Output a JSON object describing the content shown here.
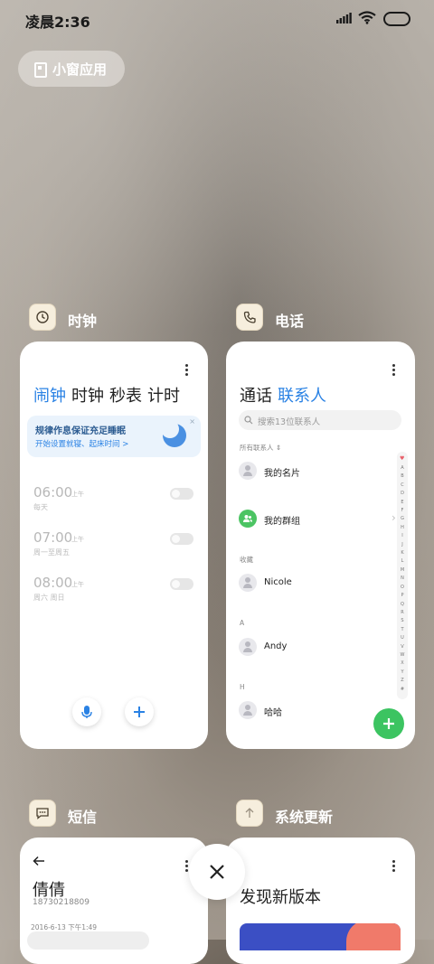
{
  "status_bar": {
    "time": "凌晨2:36",
    "icons": [
      "signal-icon",
      "wifi-icon",
      "battery-icon"
    ]
  },
  "small_window": {
    "label": "小窗应用",
    "icon": "small-window-icon"
  },
  "apps": {
    "clock": {
      "name": "时钟",
      "icon": "clock-icon",
      "tabs": [
        "闹钟",
        "时钟",
        "秒表",
        "计时"
      ],
      "active_tab": "闹钟",
      "banner": {
        "title": "规律作息保证充足睡眠",
        "subtitle": "开始设置就寝、起床时间 >",
        "close": "×"
      },
      "alarms": [
        {
          "time": "06:00",
          "ampm": "上午",
          "repeat": "每天",
          "enabled": false
        },
        {
          "time": "07:00",
          "ampm": "上午",
          "repeat": "周一至周五",
          "enabled": false
        },
        {
          "time": "08:00",
          "ampm": "上午",
          "repeat": "周六 周日",
          "enabled": false
        }
      ],
      "buttons": [
        "mic-icon",
        "plus-icon"
      ]
    },
    "phone": {
      "name": "电话",
      "icon": "phone-icon",
      "tabs": [
        "通话",
        "联系人"
      ],
      "active_tab": "联系人",
      "search_placeholder": "搜索13位联系人",
      "all_contacts_label": "所有联系人 ⇕",
      "contacts": {
        "my_card": "我的名片",
        "my_groups": "我的群组",
        "favorites_label": "收藏",
        "favorite": "Nicole",
        "section_a": "A",
        "a_contact": "Andy",
        "section_h": "H",
        "h_contact": "哈哈"
      },
      "index_letters": "A\nB\nC\nD\nE\nF\nG\nH\nI\nJ\nK\nL\nM\nN\nO\nP\nQ\nR\nS\nT\nU\nV\nW\nX\nY\nZ\n#",
      "fab": "add-contact-icon"
    },
    "sms": {
      "name": "短信",
      "icon": "message-icon",
      "contact_name": "倩倩",
      "contact_number": "18730218809",
      "date": "2016-6-13 下午1:49"
    },
    "update": {
      "name": "系统更新",
      "icon": "update-arrow-icon",
      "title": "发现新版本"
    }
  },
  "colors": {
    "accent_blue": "#2a82e4",
    "fab_green": "#3cc461",
    "banner_bg": "#eaf3fc"
  }
}
